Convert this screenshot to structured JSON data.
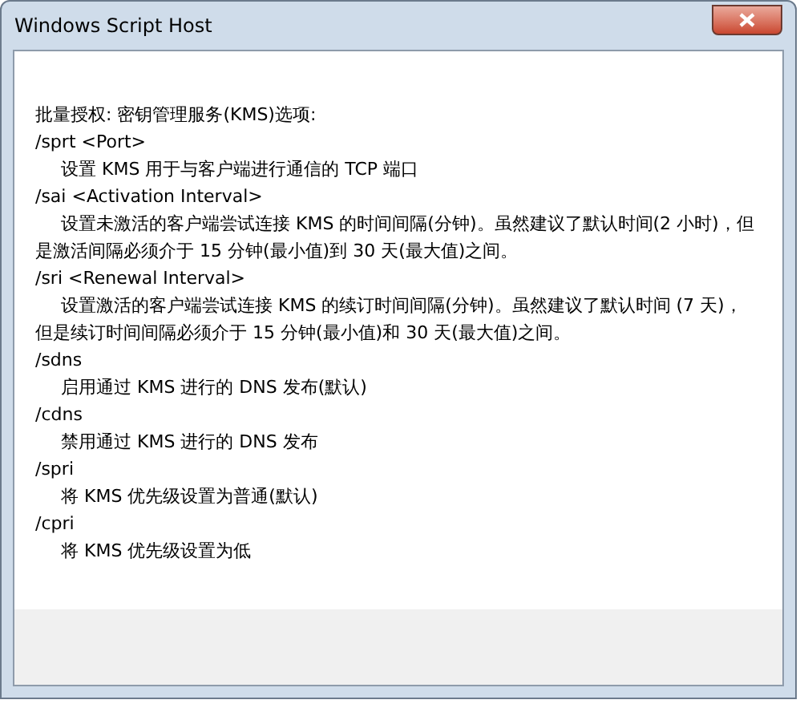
{
  "window": {
    "title": "Windows Script Host"
  },
  "message": {
    "heading": "批量授权: 密钥管理服务(KMS)选项:",
    "options": [
      {
        "name": "/sprt <Port>",
        "description": "设置 KMS 用于与客户端进行通信的 TCP 端口"
      },
      {
        "name": "/sai <Activation Interval>",
        "description": "设置未激活的客户端尝试连接 KMS 的时间间隔(分钟)。虽然建议了默认时间(2 小时)，但是激活间隔必须介于 15 分钟(最小值)到 30 天(最大值)之间。"
      },
      {
        "name": "/sri <Renewal Interval>",
        "description": "设置激活的客户端尝试连接 KMS 的续订时间间隔(分钟)。虽然建议了默认时间 (7 天)，但是续订时间间隔必须介于 15 分钟(最小值)和 30 天(最大值)之间。"
      },
      {
        "name": "/sdns",
        "description": "启用通过 KMS 进行的 DNS 发布(默认)"
      },
      {
        "name": "/cdns",
        "description": "禁用通过 KMS 进行的 DNS 发布"
      },
      {
        "name": "/spri",
        "description": "将 KMS 优先级设置为普通(默认)"
      },
      {
        "name": "/cpri",
        "description": "将 KMS 优先级设置为低"
      }
    ]
  }
}
